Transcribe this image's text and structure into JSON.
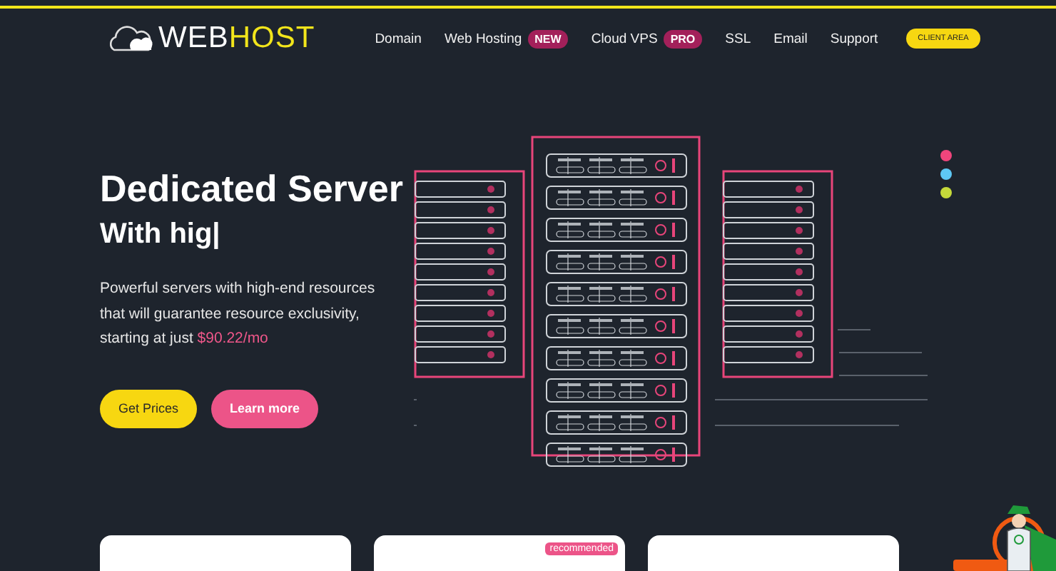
{
  "logo": {
    "part_1": "WEB",
    "part_2": "HOST"
  },
  "nav": {
    "items": [
      {
        "label": "Domain"
      },
      {
        "label": "Web Hosting",
        "badge": "NEW"
      },
      {
        "label": "Cloud VPS",
        "badge": "PRO"
      },
      {
        "label": "SSL"
      },
      {
        "label": "Email"
      },
      {
        "label": "Support"
      }
    ],
    "client_button": "CLIENT AREA"
  },
  "hero": {
    "title": "Dedicated Server",
    "subtitle": "With hig|",
    "description": "Powerful servers with high-end resources that will guarantee resource exclusivity, starting at just ",
    "price": "$90.22/mo",
    "buttons": [
      {
        "label": "Get Prices",
        "kind": "primary"
      },
      {
        "label": "Learn more",
        "kind": "secondary"
      }
    ]
  },
  "slide_dots": [
    {
      "color": "#f0457c"
    },
    {
      "color": "#5ec8f5"
    },
    {
      "color": "#c5d93a"
    }
  ],
  "plans": {
    "recommended_badge": "recommended",
    "cards": [
      {
        "recommended": false
      },
      {
        "recommended": true
      },
      {
        "recommended": false
      }
    ]
  }
}
